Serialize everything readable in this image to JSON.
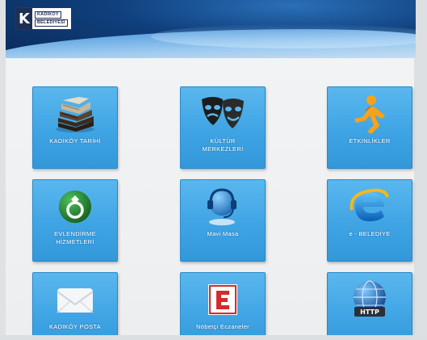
{
  "header": {
    "logo_letter": "K",
    "logo_line1": "KADIKÖY",
    "logo_line2": "BELEDİYESİ"
  },
  "tiles": [
    {
      "label": "KADIKÖY TARİHİ",
      "icon": "stacked-books-icon"
    },
    {
      "label": "KÜLTÜR\nMERKEZLERİ",
      "icon": "theater-masks-icon"
    },
    {
      "label": "ETKİNLİKLER",
      "icon": "running-person-icon"
    },
    {
      "label": "EVLENDİRME\nHİZMETLERİ",
      "icon": "wedding-ring-icon"
    },
    {
      "label": "Mavi Masa",
      "icon": "headset-globe-icon"
    },
    {
      "label": "e - BELEDİYE",
      "icon": "internet-explorer-icon"
    },
    {
      "label": "KADIKÖY POSTA",
      "icon": "envelope-icon"
    },
    {
      "label": "Nöbetçi Eczaneler",
      "icon": "pharmacy-e-icon"
    },
    {
      "label": "",
      "icon": "http-globe-icon"
    }
  ],
  "colors": {
    "tile_blue": "#3fa4e4",
    "header_navy": "#0f3f7c",
    "pharmacy_red": "#d42a2a"
  }
}
